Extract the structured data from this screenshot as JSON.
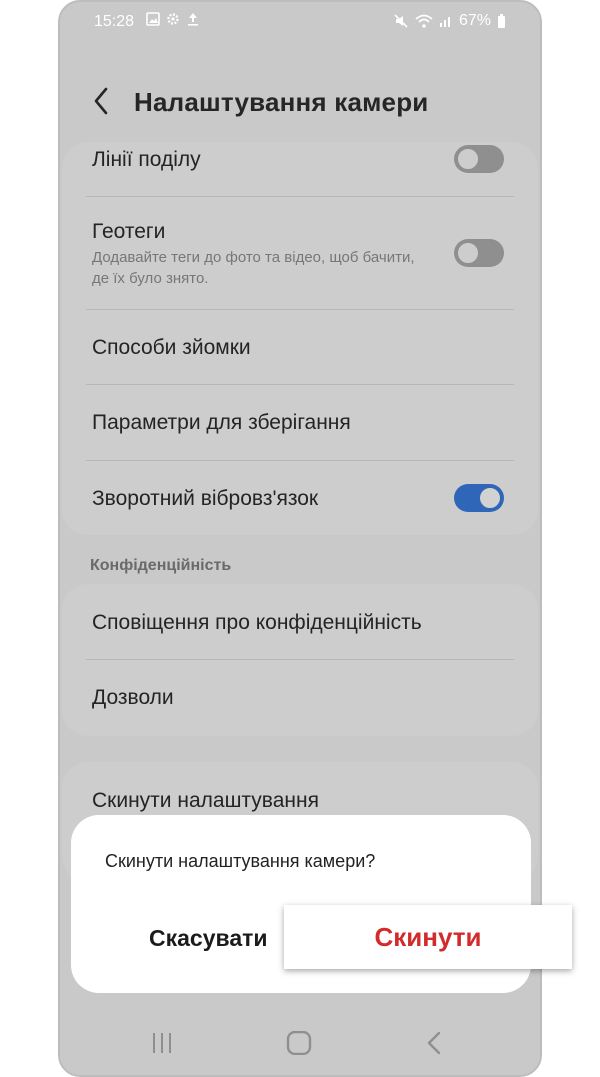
{
  "status_bar": {
    "time": "15:28",
    "battery": "67%"
  },
  "header": {
    "title": "Налаштування камери"
  },
  "settings": {
    "grid_lines": "Лінії поділу",
    "geotags": "Геотеги",
    "geotags_desc": "Додавайте теги до фото та відео, щоб бачити, де їх було знято.",
    "shooting_methods": "Способи зйомки",
    "storage_options": "Параметри для зберігання",
    "haptic_feedback": "Зворотний вібровз'язок"
  },
  "privacy": {
    "section_title": "Конфіденційність",
    "privacy_notice": "Сповіщення про конфіденційність",
    "permissions": "Дозволи"
  },
  "reset_card": {
    "reset_settings": "Скинути налаштування"
  },
  "dialog": {
    "message": "Скинути налаштування камери?",
    "cancel_label": "Скасувати",
    "reset_label": "Скинути"
  },
  "toggles": {
    "grid_lines": false,
    "geotags": false,
    "haptic_feedback": true
  },
  "colors": {
    "accent": "#2f66b8",
    "destructive": "#d22b2b"
  },
  "icons": [
    "gallery-icon",
    "settings-icon",
    "upload-icon",
    "mute-icon",
    "wifi-icon",
    "signal-icon",
    "battery-icon",
    "back-arrow-icon",
    "recent-apps-icon",
    "home-icon",
    "back-nav-icon"
  ]
}
